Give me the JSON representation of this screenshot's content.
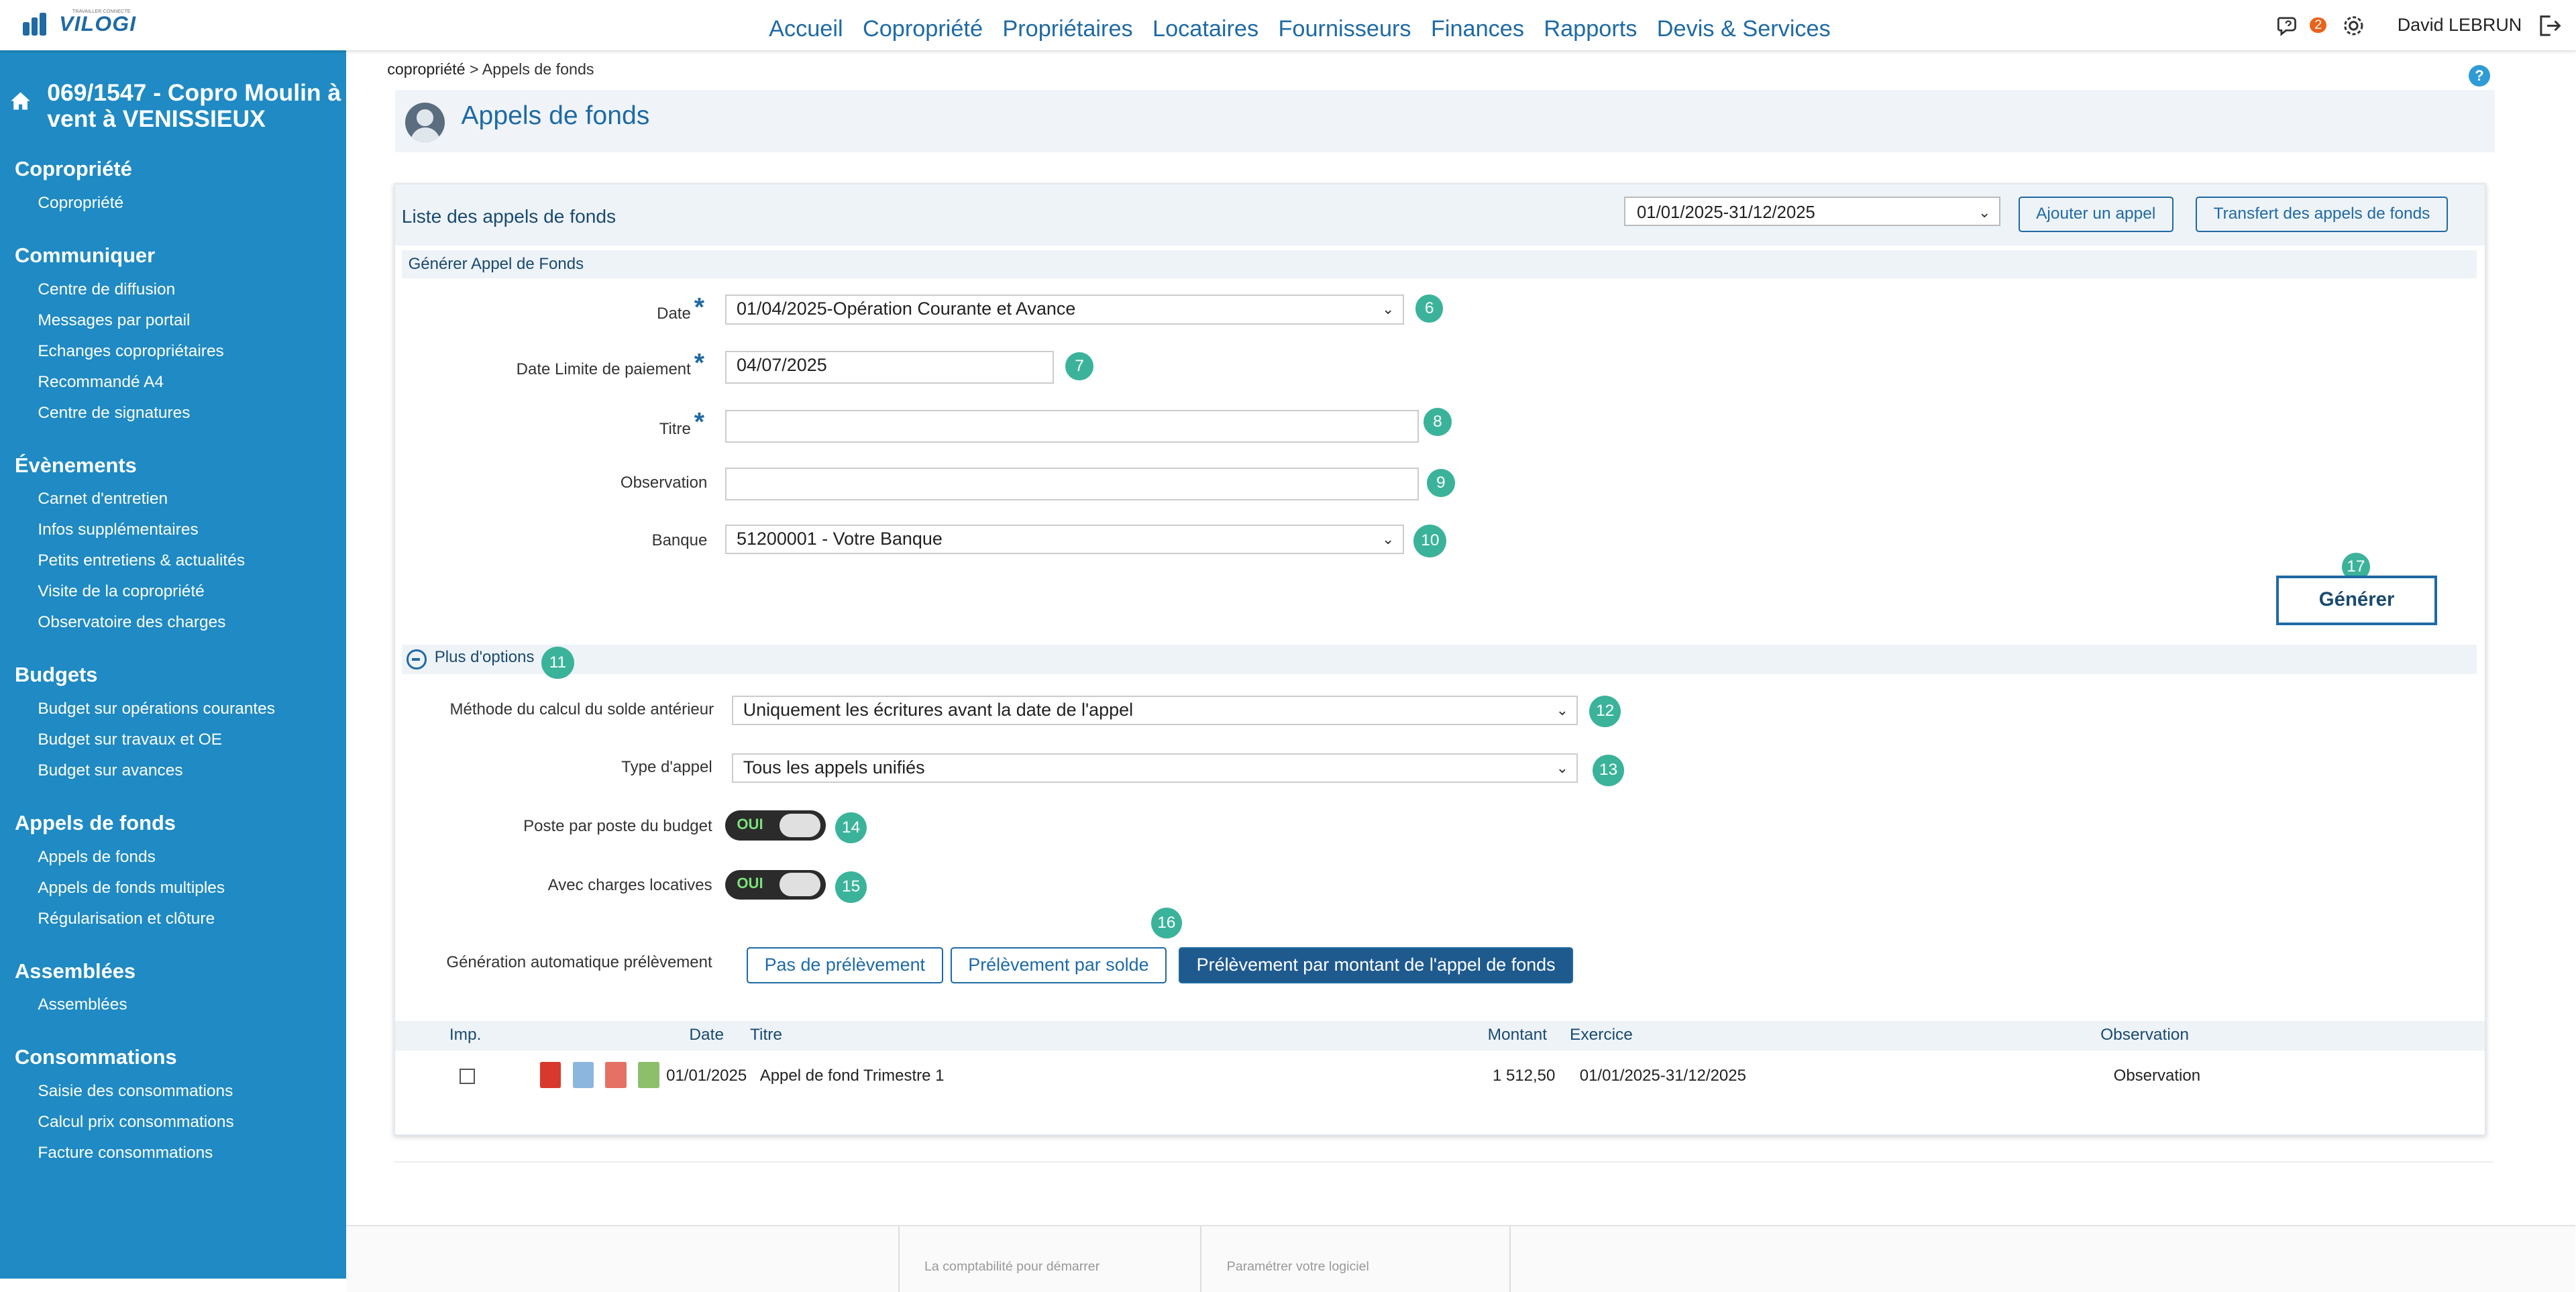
{
  "app": {
    "logo_text": "VILOGI",
    "logo_tagline": "TRAVAILLER CONNECTE",
    "nav": [
      "Accueil",
      "Copropriété",
      "Propriétaires",
      "Locataires",
      "Fournisseurs",
      "Finances",
      "Rapports",
      "Devis & Services"
    ],
    "notification_count": "2",
    "user_name": "David LEBRUN",
    "icons": {
      "chat": "chat-icon",
      "settings": "gear-icon",
      "logout": "logout-icon"
    }
  },
  "sidebar": {
    "copro_title": "069/1547 - Copro Moulin à vent à VENISSIEUX",
    "sections": [
      {
        "title": "Copropriété",
        "items": [
          "Copropriété"
        ]
      },
      {
        "title": "Communiquer",
        "items": [
          "Centre de diffusion",
          "Messages par portail",
          "Echanges copropriétaires",
          "Recommandé A4",
          "Centre de signatures"
        ]
      },
      {
        "title": "Évènements",
        "items": [
          "Carnet d'entretien",
          "Infos supplémentaires",
          "Petits entretiens & actualités",
          "Visite de la copropriété",
          "Observatoire des charges"
        ]
      },
      {
        "title": "Budgets",
        "items": [
          "Budget sur opérations courantes",
          "Budget sur travaux et OE",
          "Budget sur avances"
        ]
      },
      {
        "title": "Appels de fonds",
        "items": [
          "Appels de fonds",
          "Appels de fonds multiples",
          "Régularisation et clôture"
        ]
      },
      {
        "title": "Assemblées",
        "items": [
          "Assemblées"
        ]
      },
      {
        "title": "Consommations",
        "items": [
          "Saisie des consommations",
          "Calcul prix consommations",
          "Facture consommations"
        ]
      }
    ],
    "accent_color": "#1f8ac3"
  },
  "main": {
    "breadcrumb_root": "copropriété",
    "breadcrumb_sep": ">",
    "breadcrumb_current": "Appels de fonds",
    "help": "?",
    "page_title": "Appels de fonds",
    "panel_title": "Liste des appels de fonds",
    "period_value": "01/01/2025-31/12/2025",
    "add_button": "Ajouter un appel",
    "transfer_button": "Transfert des appels de fonds",
    "form_title": "Générer Appel de Fonds",
    "required_mark": "*",
    "fields": {
      "date_label": "Date",
      "date_value": "01/04/2025-Opération Courante et Avance",
      "date_num": "6",
      "deadline_label": "Date Limite de paiement",
      "deadline_value": "04/07/2025",
      "deadline_num": "7",
      "title_label": "Titre",
      "title_value": "",
      "title_num": "8",
      "observation_label": "Observation",
      "observation_value": "",
      "observation_num": "9",
      "bank_label": "Banque",
      "bank_value": "51200001 - Votre Banque",
      "bank_num": "10"
    },
    "generate_button": "Générer",
    "generate_num": "17",
    "options_title": "Plus d'options",
    "options_num": "11",
    "method_label": "Méthode du calcul du solde antérieur",
    "method_value": "Uniquement les écritures avant la date de l'appel",
    "method_num": "12",
    "type_label": "Type d'appel",
    "type_value": "Tous les appels unifiés",
    "type_num": "13",
    "budget_toggle_label": "Poste par poste du budget",
    "budget_toggle_value": "OUI",
    "budget_toggle_num": "14",
    "charges_toggle_label": "Avec charges locatives",
    "charges_toggle_value": "OUI",
    "charges_toggle_num": "15",
    "prelevement_label": "Génération automatique prélèvement",
    "prelevement_num": "16",
    "prelevement_options": [
      "Pas de prélèvement",
      "Prélèvement par solde",
      "Prélèvement par montant de l'appel de fonds"
    ],
    "prelevement_selected": "Prélèvement par montant de l'appel de fonds",
    "table": {
      "headers": [
        "Imp.",
        "Date",
        "Titre",
        "Montant",
        "Exercice",
        "Observation"
      ],
      "rows": [
        {
          "date": "01/01/2025",
          "titre": "Appel de fond Trimestre 1",
          "montant": "1 512,50",
          "exercice": "01/01/2025-31/12/2025",
          "observation": "Observation"
        }
      ]
    },
    "footer_text_1": "La comptabilité pour démarrer",
    "footer_text_2": "Paramétrer votre logiciel"
  }
}
